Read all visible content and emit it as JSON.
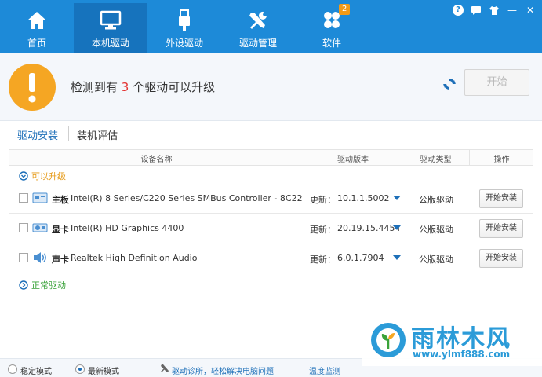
{
  "nav": {
    "tabs": [
      {
        "label": "首页",
        "icon": "home-icon"
      },
      {
        "label": "本机驱动",
        "icon": "monitor-icon"
      },
      {
        "label": "外设驱动",
        "icon": "usb-icon"
      },
      {
        "label": "驱动管理",
        "icon": "tools-icon"
      },
      {
        "label": "软件",
        "icon": "apps-icon"
      }
    ],
    "active_tab": "本机驱动",
    "software_badge": "2"
  },
  "window_controls": {
    "help": "?",
    "feedback": "feedback-icon",
    "skin": "skin-icon",
    "minimize": "—",
    "close": "✕"
  },
  "alert": {
    "prefix": "检测到有",
    "count": "3",
    "suffix": "个驱动可以升级",
    "start_label": "开始"
  },
  "subtabs": {
    "install": "驱动安装",
    "evaluate": "装机评估"
  },
  "table": {
    "headers": {
      "name": "设备名称",
      "version": "驱动版本",
      "type": "驱动类型",
      "action": "操作"
    },
    "group_upgradable": "可以升级",
    "group_normal": "正常驱动",
    "rows": [
      {
        "category": "主板",
        "name": "Intel(R) 8 Series/C220 Series SMBus Controller - 8C22",
        "ver_label": "更新：",
        "version": "10.1.1.5002",
        "drv_type": "公版驱动",
        "button": "开始安装",
        "icon": "board-icon"
      },
      {
        "category": "显卡",
        "name": "Intel(R) HD Graphics 4400",
        "ver_label": "更新：",
        "version": "20.19.15.4454",
        "drv_type": "公版驱动",
        "button": "开始安装",
        "icon": "gpu-icon"
      },
      {
        "category": "声卡",
        "name": "Realtek High Definition Audio",
        "ver_label": "更新：",
        "version": "6.0.1.7904",
        "drv_type": "公版驱动",
        "button": "开始安装",
        "icon": "speaker-icon"
      }
    ]
  },
  "bottom": {
    "mode_stable": "稳定模式",
    "mode_latest": "最新模式",
    "selected_mode": "最新模式",
    "diagnose_link": "驱动诊所，轻松解决电脑问题",
    "temp_link": "温度监测"
  },
  "watermark": {
    "title": "雨林木风",
    "url": "www.ylmf888.com"
  },
  "colors": {
    "nav_bg": "#1d8ad8",
    "nav_active": "#1673bd",
    "warning": "#f5a623",
    "count": "#e3302f",
    "upgradable": "#e69a17",
    "normal": "#3aa33a"
  }
}
